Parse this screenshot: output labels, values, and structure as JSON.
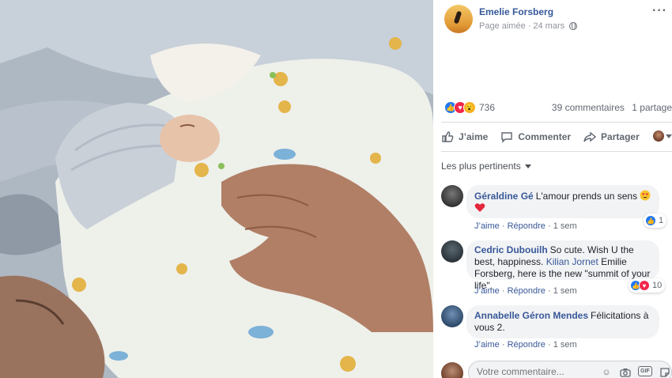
{
  "post": {
    "page_name": "Emelie Forsberg",
    "page_liked": "Page aimée",
    "separator": "·",
    "date": "24 mars"
  },
  "reactions": {
    "count": "736",
    "comments": "39 commentaires",
    "shares": "1 partage"
  },
  "actions": {
    "like": "J’aime",
    "comment": "Commenter",
    "share": "Partager"
  },
  "sort_label": "Les plus pertinents",
  "comments": [
    {
      "author": "Géraldine Gé",
      "text": "L'amour prends un sens",
      "like": "J’aime",
      "reply": "Répondre",
      "time": "1 sem",
      "reaction_count": "1"
    },
    {
      "author": "Cedric Dubouilh",
      "text_before": "So cute. Wish U the best, happiness.",
      "mention": "Kilian Jornet",
      "text_after": "Emilie Forsberg, here is the new \"summit of your life\".",
      "like": "J’aime",
      "reply": "Répondre",
      "time": "1 sem",
      "reaction_count": "10"
    },
    {
      "author": "Annabelle Géron Mendes",
      "text": "Félicitations à vous 2.",
      "like": "J’aime",
      "reply": "Répondre",
      "time": "1 sem"
    }
  ],
  "composer": {
    "placeholder": "Votre commentaire..."
  },
  "colors": {
    "link": "#385898",
    "like_blue": "#2078f4",
    "love_red": "#f0284a",
    "wow_yellow": "#f7b125"
  }
}
